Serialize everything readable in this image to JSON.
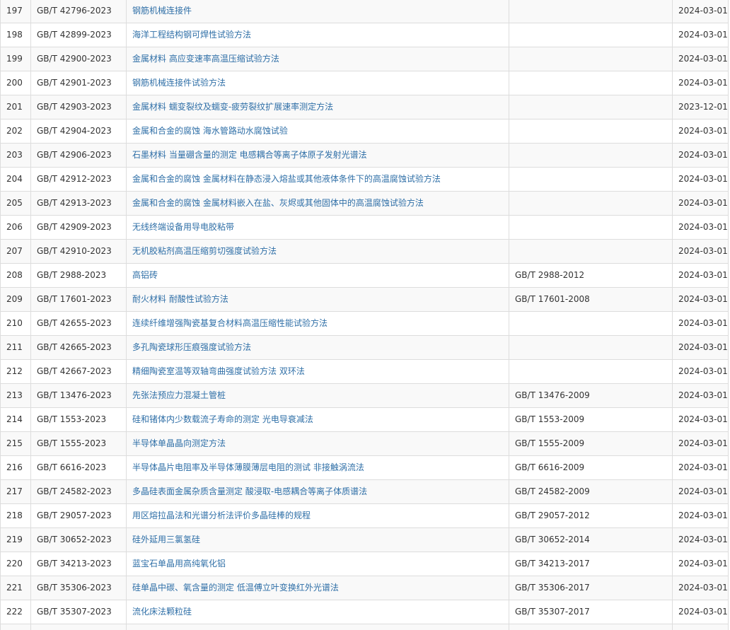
{
  "rows": [
    {
      "no": "197",
      "code": "GB/T 42796-2023",
      "name": "钢筋机械连接件",
      "replaces": "",
      "date": "2024-03-01"
    },
    {
      "no": "198",
      "code": "GB/T 42899-2023",
      "name": "海洋工程结构钢可焊性试验方法",
      "replaces": "",
      "date": "2024-03-01"
    },
    {
      "no": "199",
      "code": "GB/T 42900-2023",
      "name": "金属材料 高应变速率高温压缩试验方法",
      "replaces": "",
      "date": "2024-03-01"
    },
    {
      "no": "200",
      "code": "GB/T 42901-2023",
      "name": "钢筋机械连接件试验方法",
      "replaces": "",
      "date": "2024-03-01"
    },
    {
      "no": "201",
      "code": "GB/T 42903-2023",
      "name": "金属材料 蠕变裂纹及蠕变-疲劳裂纹扩展速率测定方法",
      "replaces": "",
      "date": "2023-12-01"
    },
    {
      "no": "202",
      "code": "GB/T 42904-2023",
      "name": "金属和合金的腐蚀 海水管路动水腐蚀试验",
      "replaces": "",
      "date": "2024-03-01"
    },
    {
      "no": "203",
      "code": "GB/T 42906-2023",
      "name": "石墨材料 当量硼含量的测定 电感耦合等离子体原子发射光谱法",
      "replaces": "",
      "date": "2024-03-01"
    },
    {
      "no": "204",
      "code": "GB/T 42912-2023",
      "name": "金属和合金的腐蚀 金属材料在静态浸入熔盐或其他液体条件下的高温腐蚀试验方法",
      "replaces": "",
      "date": "2024-03-01"
    },
    {
      "no": "205",
      "code": "GB/T 42913-2023",
      "name": "金属和合金的腐蚀 金属材料嵌入在盐、灰烬或其他固体中的高温腐蚀试验方法",
      "replaces": "",
      "date": "2024-03-01"
    },
    {
      "no": "206",
      "code": "GB/T 42909-2023",
      "name": "无线终端设备用导电胶粘带",
      "replaces": "",
      "date": "2024-03-01"
    },
    {
      "no": "207",
      "code": "GB/T 42910-2023",
      "name": "无机胶粘剂高温压缩剪切强度试验方法",
      "replaces": "",
      "date": "2024-03-01"
    },
    {
      "no": "208",
      "code": "GB/T 2988-2023",
      "name": "高铝砖",
      "replaces": "GB/T 2988-2012",
      "date": "2024-03-01"
    },
    {
      "no": "209",
      "code": "GB/T 17601-2023",
      "name": "耐火材料 耐酸性试验方法",
      "replaces": "GB/T 17601-2008",
      "date": "2024-03-01"
    },
    {
      "no": "210",
      "code": "GB/T 42655-2023",
      "name": "连续纤维增强陶瓷基复合材料高温压缩性能试验方法",
      "replaces": "",
      "date": "2024-03-01"
    },
    {
      "no": "211",
      "code": "GB/T 42665-2023",
      "name": "多孔陶瓷球形压痕强度试验方法",
      "replaces": "",
      "date": "2024-03-01"
    },
    {
      "no": "212",
      "code": "GB/T 42667-2023",
      "name": "精细陶瓷室温等双轴弯曲强度试验方法 双环法",
      "replaces": "",
      "date": "2024-03-01"
    },
    {
      "no": "213",
      "code": "GB/T 13476-2023",
      "name": "先张法预应力混凝土管桩",
      "replaces": "GB/T 13476-2009",
      "date": "2024-03-01"
    },
    {
      "no": "214",
      "code": "GB/T 1553-2023",
      "name": "硅和锗体内少数载流子寿命的测定 光电导衰减法",
      "replaces": "GB/T 1553-2009",
      "date": "2024-03-01"
    },
    {
      "no": "215",
      "code": "GB/T 1555-2023",
      "name": "半导体单晶晶向测定方法",
      "replaces": "GB/T 1555-2009",
      "date": "2024-03-01"
    },
    {
      "no": "216",
      "code": "GB/T 6616-2023",
      "name": "半导体晶片电阻率及半导体薄膜薄层电阻的测试 非接触涡流法",
      "replaces": "GB/T 6616-2009",
      "date": "2024-03-01"
    },
    {
      "no": "217",
      "code": "GB/T 24582-2023",
      "name": "多晶硅表面金属杂质含量测定 酸浸取-电感耦合等离子体质谱法",
      "replaces": "GB/T 24582-2009",
      "date": "2024-03-01"
    },
    {
      "no": "218",
      "code": "GB/T 29057-2023",
      "name": "用区熔拉晶法和光谱分析法评价多晶硅棒的规程",
      "replaces": "GB/T 29057-2012",
      "date": "2024-03-01"
    },
    {
      "no": "219",
      "code": "GB/T 30652-2023",
      "name": "硅外延用三氯氢硅",
      "replaces": "GB/T 30652-2014",
      "date": "2024-03-01"
    },
    {
      "no": "220",
      "code": "GB/T 34213-2023",
      "name": "蓝宝石单晶用高纯氧化铝",
      "replaces": "GB/T 34213-2017",
      "date": "2024-03-01"
    },
    {
      "no": "221",
      "code": "GB/T 35306-2023",
      "name": "硅单晶中碳、氧含量的测定 低温傅立叶变换红外光谱法",
      "replaces": "GB/T 35306-2017",
      "date": "2024-03-01"
    },
    {
      "no": "222",
      "code": "GB/T 35307-2023",
      "name": "流化床法颗粒硅",
      "replaces": "GB/T 35307-2017",
      "date": "2024-03-01"
    },
    {
      "no": "",
      "code": "",
      "name": "",
      "replaces": "",
      "date": ""
    }
  ]
}
